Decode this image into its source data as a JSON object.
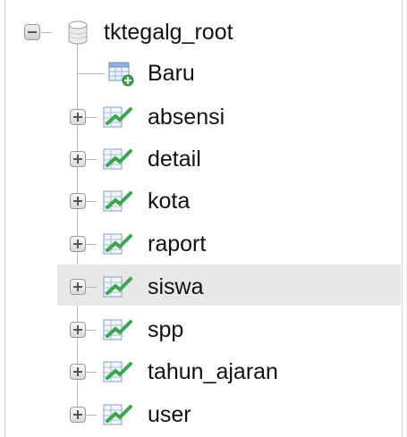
{
  "tree": {
    "root": {
      "label": "tktegalg_root",
      "icon": "database-icon",
      "expanded": true
    },
    "new_item": {
      "label": "Baru",
      "icon": "new-table-icon"
    },
    "tables": [
      {
        "label": "absensi",
        "icon": "table-icon",
        "highlighted": false
      },
      {
        "label": "detail",
        "icon": "table-icon",
        "highlighted": false
      },
      {
        "label": "kota",
        "icon": "table-icon",
        "highlighted": false
      },
      {
        "label": "raport",
        "icon": "table-icon",
        "highlighted": false
      },
      {
        "label": "siswa",
        "icon": "table-icon",
        "highlighted": true
      },
      {
        "label": "spp",
        "icon": "table-icon",
        "highlighted": false
      },
      {
        "label": "tahun_ajaran",
        "icon": "table-icon",
        "highlighted": false
      },
      {
        "label": "user",
        "icon": "table-icon",
        "highlighted": false
      }
    ]
  },
  "colors": {
    "highlight": "#e8e8e8",
    "tree_line": "#b7b7b7",
    "table_icon_green": "#3aa84a",
    "table_icon_blue": "#6a8fc7"
  }
}
